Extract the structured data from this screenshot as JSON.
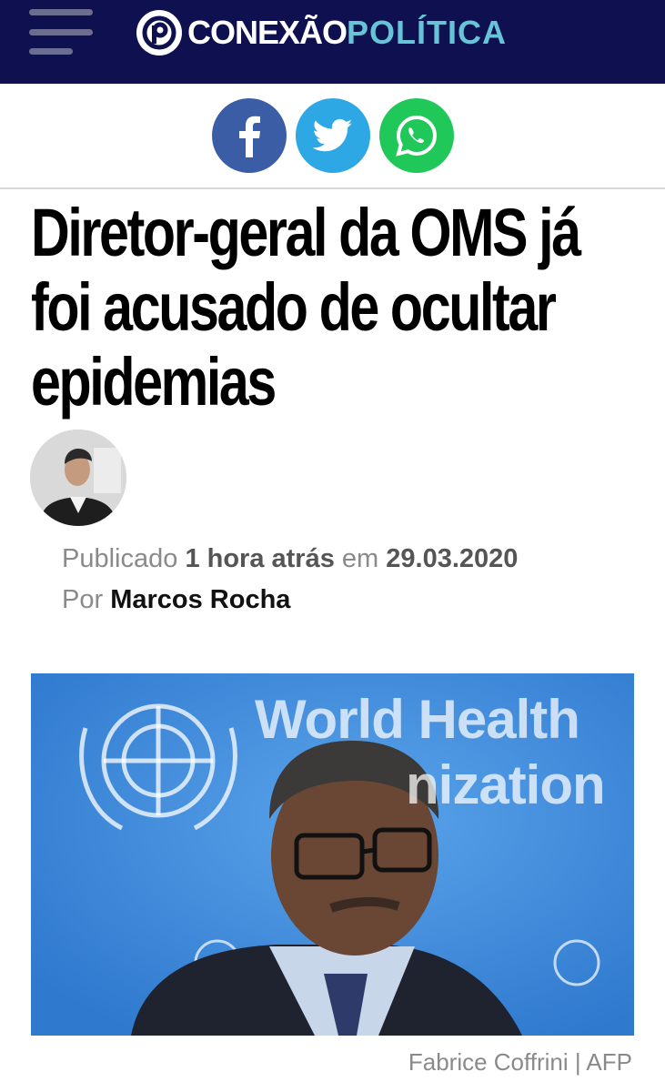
{
  "header": {
    "logo_primary": "CONEXÃO",
    "logo_secondary": "POLÍTICA",
    "background_color": "#0e1050",
    "accent_color": "#67c4d8"
  },
  "share": {
    "facebook_icon": "facebook-icon",
    "twitter_icon": "twitter-icon",
    "whatsapp_icon": "whatsapp-icon"
  },
  "article": {
    "headline": "Diretor-geral da OMS já foi acusado de ocultar epidemias",
    "published_label": "Publicado",
    "published_relative": "1 hora atrás",
    "published_on_label": "em",
    "published_date": "29.03.2020",
    "by_label": "Por",
    "author": "Marcos Rocha"
  },
  "hero_image": {
    "sign_line_1": "World Health",
    "sign_line_2": "nization",
    "caption": "Fabrice Coffrini | AFP"
  }
}
